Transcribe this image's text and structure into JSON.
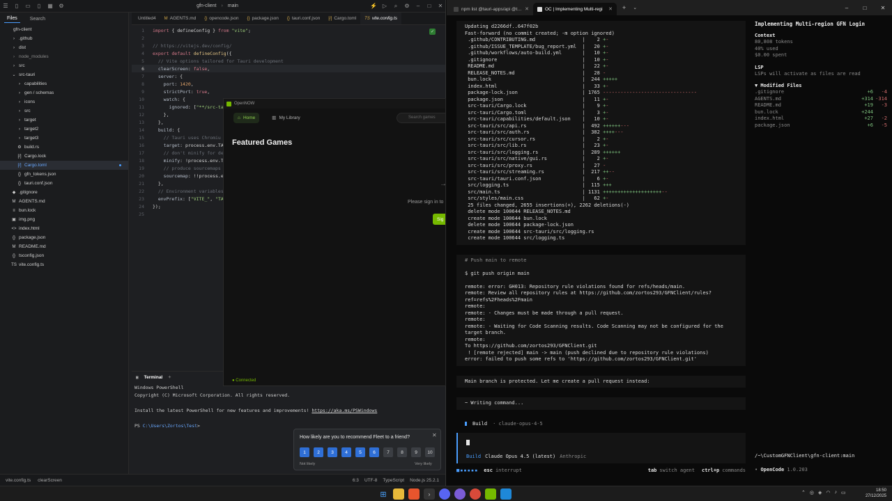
{
  "ide": {
    "title": "gfn-client",
    "branch": "main",
    "sidebar_tabs": [
      "Files",
      "Search"
    ],
    "tree": [
      {
        "label": "gfn-client",
        "icon": "",
        "indent": 0,
        "kind": "root"
      },
      {
        "label": ".github",
        "icon": "›",
        "indent": 1,
        "kind": "folder"
      },
      {
        "label": "dist",
        "icon": "›",
        "indent": 1,
        "kind": "folder"
      },
      {
        "label": "node_modules",
        "icon": "›",
        "indent": 1,
        "kind": "folder-dim"
      },
      {
        "label": "src",
        "icon": "›",
        "indent": 1,
        "kind": "folder"
      },
      {
        "label": "src-tauri",
        "icon": "⌄",
        "indent": 1,
        "kind": "folder"
      },
      {
        "label": "capabilities",
        "icon": "›",
        "indent": 2,
        "kind": "folder"
      },
      {
        "label": "gen / schemas",
        "icon": "›",
        "indent": 2,
        "kind": "folder"
      },
      {
        "label": "icons",
        "icon": "›",
        "indent": 2,
        "kind": "folder"
      },
      {
        "label": "src",
        "icon": "›",
        "indent": 2,
        "kind": "folder"
      },
      {
        "label": "target",
        "icon": "›",
        "indent": 2,
        "kind": "folder"
      },
      {
        "label": "target2",
        "icon": "›",
        "indent": 2,
        "kind": "folder"
      },
      {
        "label": "target3",
        "icon": "›",
        "indent": 2,
        "kind": "folder"
      },
      {
        "label": "build.rs",
        "icon": "⚙",
        "indent": 2,
        "kind": "file"
      },
      {
        "label": "Cargo.lock",
        "icon": "[/]",
        "indent": 2,
        "kind": "file"
      },
      {
        "label": "Cargo.toml",
        "icon": "[/]",
        "indent": 2,
        "kind": "modified"
      },
      {
        "label": "gfn_tokens.json",
        "icon": "{}",
        "indent": 2,
        "kind": "file"
      },
      {
        "label": "tauri.conf.json",
        "icon": "{}",
        "indent": 2,
        "kind": "file"
      },
      {
        "label": ".gitignore",
        "icon": "◆",
        "indent": 1,
        "kind": "file"
      },
      {
        "label": "AGENTS.md",
        "icon": "M",
        "indent": 1,
        "kind": "file"
      },
      {
        "label": "bun.lock",
        "icon": "≡",
        "indent": 1,
        "kind": "file"
      },
      {
        "label": "img.png",
        "icon": "▣",
        "indent": 1,
        "kind": "file"
      },
      {
        "label": "index.html",
        "icon": "<>",
        "indent": 1,
        "kind": "file"
      },
      {
        "label": "package.json",
        "icon": "{}",
        "indent": 1,
        "kind": "file"
      },
      {
        "label": "README.md",
        "icon": "M",
        "indent": 1,
        "kind": "file"
      },
      {
        "label": "tsconfig.json",
        "icon": "{}",
        "indent": 1,
        "kind": "file"
      },
      {
        "label": "vite.config.ts",
        "icon": "TS",
        "indent": 1,
        "kind": "file"
      }
    ],
    "editor_tabs": [
      {
        "label": "Untitled4",
        "icon": "",
        "active": false
      },
      {
        "label": "AGENTS.md",
        "icon": "M",
        "active": false
      },
      {
        "label": "opencode.json",
        "icon": "{}",
        "active": false
      },
      {
        "label": "package.json",
        "icon": "{}",
        "active": false
      },
      {
        "label": "tauri.conf.json",
        "icon": "{}",
        "active": false
      },
      {
        "label": "Cargo.toml",
        "icon": "[/]",
        "active": false
      },
      {
        "label": "vite.config.ts",
        "icon": "TS",
        "active": true
      }
    ],
    "code_lines": [
      {
        "n": "1",
        "t": [
          [
            "kw",
            "import"
          ],
          [
            "id",
            " { defineConfig } "
          ],
          [
            "kw",
            "from"
          ],
          [
            "str",
            " \"vite\""
          ],
          [
            "id",
            ";"
          ]
        ]
      },
      {
        "n": "2",
        "t": []
      },
      {
        "n": "3",
        "t": [
          [
            "cm",
            "// https://vitejs.dev/config/"
          ]
        ]
      },
      {
        "n": "4",
        "t": [
          [
            "kw",
            "export default "
          ],
          [
            "fn",
            "defineConfig"
          ],
          [
            "id",
            "({"
          ]
        ]
      },
      {
        "n": "5",
        "t": [
          [
            "cm",
            "  // Vite options tailored for Tauri development"
          ]
        ]
      },
      {
        "n": "6",
        "t": [
          [
            "prop",
            "  clearScreen"
          ],
          [
            "id",
            ": "
          ],
          [
            "kw",
            "false"
          ],
          [
            "id",
            ","
          ]
        ],
        "cur": true
      },
      {
        "n": "7",
        "t": [
          [
            "prop",
            "  server"
          ],
          [
            "id",
            ": {"
          ]
        ]
      },
      {
        "n": "8",
        "t": [
          [
            "prop",
            "    port"
          ],
          [
            "id",
            ": "
          ],
          [
            "num",
            "1420"
          ],
          [
            "id",
            ","
          ]
        ]
      },
      {
        "n": "9",
        "t": [
          [
            "prop",
            "    strictPort"
          ],
          [
            "id",
            ": "
          ],
          [
            "kw",
            "true"
          ],
          [
            "id",
            ","
          ]
        ]
      },
      {
        "n": "10",
        "t": [
          [
            "prop",
            "    watch"
          ],
          [
            "id",
            ": {"
          ]
        ]
      },
      {
        "n": "11",
        "t": [
          [
            "prop",
            "      ignored"
          ],
          [
            "id",
            ": ["
          ],
          [
            "str",
            "\"**/src-ta"
          ]
        ]
      },
      {
        "n": "12",
        "t": [
          [
            "id",
            "    },"
          ]
        ]
      },
      {
        "n": "13",
        "t": [
          [
            "id",
            "  },"
          ]
        ]
      },
      {
        "n": "14",
        "t": [
          [
            "prop",
            "  build"
          ],
          [
            "id",
            ": {"
          ]
        ]
      },
      {
        "n": "15",
        "t": [
          [
            "cm",
            "    // Tauri uses Chromiu"
          ]
        ]
      },
      {
        "n": "16",
        "t": [
          [
            "prop",
            "    target"
          ],
          [
            "id",
            ": process.env.TA"
          ]
        ]
      },
      {
        "n": "17",
        "t": [
          [
            "cm",
            "    // don't minify for de"
          ]
        ]
      },
      {
        "n": "18",
        "t": [
          [
            "prop",
            "    minify"
          ],
          [
            "id",
            ": !process.env.T"
          ]
        ]
      },
      {
        "n": "19",
        "t": [
          [
            "cm",
            "    // produce sourcemaps"
          ]
        ]
      },
      {
        "n": "20",
        "t": [
          [
            "prop",
            "    sourcemap"
          ],
          [
            "id",
            ": !!process.e"
          ]
        ]
      },
      {
        "n": "21",
        "t": [
          [
            "id",
            "  },"
          ]
        ]
      },
      {
        "n": "22",
        "t": [
          [
            "cm",
            "  // Environment variables"
          ]
        ]
      },
      {
        "n": "23",
        "t": [
          [
            "prop",
            "  envPrefix"
          ],
          [
            "id",
            ": ["
          ],
          [
            "str",
            "\"VITE_\""
          ],
          [
            "id",
            ", "
          ],
          [
            "str",
            "\"TA"
          ]
        ]
      },
      {
        "n": "24",
        "t": [
          [
            "id",
            "});"
          ]
        ]
      },
      {
        "n": "25",
        "t": []
      }
    ],
    "terminal": {
      "tab": "Terminal",
      "lines": [
        "Windows PowerShell",
        "Copyright (C) Microsoft Corporation. All rights reserved.",
        "",
        "Install the latest PowerShell for new features and improvements! "
      ],
      "link": "https://aka.ms/PSWindows",
      "prompt_prefix": "PS ",
      "prompt_path": "C:\\Users\\Zortos\\Test",
      "prompt_suffix": ">"
    },
    "status": {
      "file": "vite.config.ts",
      "symbol": "clearScreen",
      "position": "6:3",
      "encoding": "UTF-8",
      "language": "TypeScript",
      "runtime": "Node.js 25.2.1"
    }
  },
  "opennow": {
    "title": "OpenNOW",
    "nav_home": "Home",
    "nav_library": "My Library",
    "search_placeholder": "Search games",
    "heading": "Featured Games",
    "please": "Please sign in to",
    "signin": "Sig",
    "status": "● Connected"
  },
  "survey": {
    "question": "How likely are you to recommend Fleet to a friend?",
    "numbers": [
      "1",
      "2",
      "3",
      "4",
      "5",
      "6",
      "7",
      "8",
      "9",
      "10"
    ],
    "low": "Not likely",
    "high": "Very likely"
  },
  "browser": {
    "tabs": [
      {
        "label": "npm list @tauri-apps/api @tau",
        "fav": "npm",
        "active": false
      },
      {
        "label": "OC | Implementing Multi-regi",
        "fav": "oc",
        "active": true
      }
    ]
  },
  "opencode": {
    "git_lines": [
      "Updating d2266df..647f02b",
      "Fast-forward (no commit created; -m option ignored)",
      " .github/CONTRIBUTING.md                |    2 +-",
      " .github/ISSUE_TEMPLATE/bug_report.yml  |   20 +-",
      " .github/workflows/auto-build.yml       |   10 +-",
      " .gitignore                             |   10 +-",
      " README.md                              |   22 +-",
      " RELEASE_NOTES.md                       |   28 -",
      " bun.lock                               |  244 +++++",
      " index.html                             |   33 +-",
      " package-lock.json                      | 1765 --------------------------------",
      " package.json                           |   11 +-",
      " src-tauri/Cargo.lock                   |    9 +-",
      " src-tauri/Cargo.toml                   |    3 +-",
      " src-tauri/capabilities/default.json    |   10 +-",
      " src-tauri/src/api.rs                   |  492 ++++++---",
      " src-tauri/src/auth.rs                  |  382 ++++---",
      " src-tauri/src/cursor.rs                |    2 +-",
      " src-tauri/src/lib.rs                   |   23 +-",
      " src-tauri/src/logging.rs               |  289 ++++++",
      " src-tauri/src/native/gui.rs            |    2 +-",
      " src-tauri/src/proxy.rs                 |   27 -",
      " src-tauri/src/streaming.rs             |  217 ++--",
      " src-tauri/tauri.conf.json              |    6 +-",
      " src/logging.ts                         |  115 +++",
      " src/main.ts                            | 1131 ++++++++++++++++++++--",
      " src/styles/main.css                    |   62 +-",
      " 25 files changed, 2655 insertions(+), 2262 deletions(-)",
      " delete mode 100644 RELEASE_NOTES.md",
      " create mode 100644 bun.lock",
      " delete mode 100644 package-lock.json",
      " create mode 100644 src-tauri/src/logging.rs",
      " create mode 100644 src/logging.ts"
    ],
    "push_comment": "# Push main to remote",
    "push_cmd": "$ git push origin main",
    "push_output": [
      "remote: error: GH013: Repository rule violations found for refs/heads/main.",
      "remote: Review all repository rules at https://github.com/zortos293/GFNClient/rules?",
      "ref=refs%2Fheads%2Fmain",
      "remote:",
      "remote: - Changes must be made through a pull request.",
      "remote:",
      "remote: - Waiting for Code Scanning results. Code Scanning may not be configured for the",
      "target branch.",
      "remote:",
      "To https://github.com/zortos293/GFNClient.git",
      " ! [remote rejected] main -> main (push declined due to repository rule violations)",
      "error: failed to push some refs to 'https://github.com/zortos293/GFNClient.git'"
    ],
    "message": "Main branch is protected. Let me create a pull request instead:",
    "writing": "~ Writing command...",
    "build_label": "Build",
    "build_model": "· claude-opus-4-5",
    "input_build": "Build",
    "input_model": "Claude Opus 4.5 (latest)",
    "input_vendor": "Anthropic",
    "esc": "esc",
    "esc_hint": "interrupt",
    "tab_key": "tab",
    "tab_hint": "switch agent",
    "ctrlp_key": "ctrl+p",
    "ctrlp_hint": "commands"
  },
  "oc_side": {
    "title": "Implementing Multi-region GFN Login",
    "context_h": "Context",
    "tokens": "80,808 tokens",
    "used": "40% used",
    "spent": "$0.00 spent",
    "lsp_h": "LSP",
    "lsp_t": "LSPs will activate as files are read",
    "modified_h": "▼ Modified Files",
    "files": [
      {
        "name": ".gitignore",
        "add": "+6",
        "del": "-4"
      },
      {
        "name": "AGENTS.md",
        "add": "+314",
        "del": "-314"
      },
      {
        "name": "README.md",
        "add": "+19",
        "del": "-3"
      },
      {
        "name": "bun.lock",
        "add": "+244",
        "del": ""
      },
      {
        "name": "index.html",
        "add": "+27",
        "del": "-2"
      },
      {
        "name": "package.json",
        "add": "+6",
        "del": "-5"
      }
    ],
    "path": "/~\\CustomGFNClient\\gfn-client:main",
    "version_dot": "•",
    "version_name": "OpenCode",
    "version": "1.0.203"
  },
  "taskbar": {
    "time": "18:50",
    "date": "27/12/2025"
  }
}
